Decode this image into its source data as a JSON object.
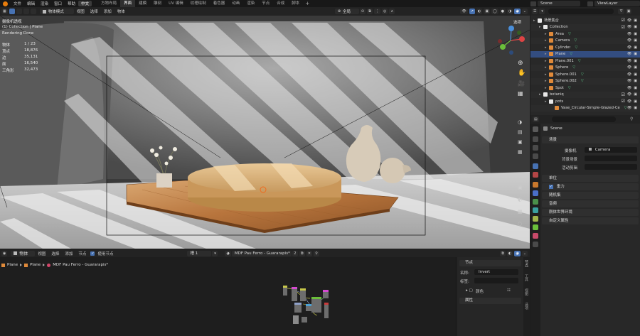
{
  "topbar": {
    "menus": [
      "文件",
      "编辑",
      "渲染",
      "窗口",
      "帮助",
      "中文"
    ],
    "workspaces": [
      "方物布局",
      "界面",
      "建模",
      "雕刻",
      "UV 编辑",
      "纹理绘制",
      "着色器",
      "动画",
      "渲染",
      "节点",
      "合成",
      "脚本"
    ],
    "active_workspace": "界面",
    "scene_label": "Scene",
    "viewlayer_label": "ViewLayer"
  },
  "viewport_header": {
    "mode": "物体模式",
    "menus": [
      "视图",
      "选择",
      "添加",
      "物体"
    ],
    "transform": "全局"
  },
  "overlay": {
    "view_name": "摄像机透视",
    "collection_object": "(1) Collection | Plane",
    "render_status": "Rendering Done",
    "stats": [
      {
        "label": "物体",
        "value": "1 / 23"
      },
      {
        "label": "顶点",
        "value": "18,876"
      },
      {
        "label": "边",
        "value": "35,131"
      },
      {
        "label": "面",
        "value": "16,540"
      },
      {
        "label": "三角形",
        "value": "32,473"
      }
    ],
    "stat_labels_short": [
      "体",
      "",
      "",
      "",
      "角形"
    ],
    "top_right_select": "选项"
  },
  "node_editor": {
    "menus": [
      "物体",
      "视图",
      "选择",
      "添加",
      "节点"
    ],
    "use_nodes_label": "使用节点",
    "slot": "槽 1",
    "material_name": "MDF Pau Ferro - Guararapis*",
    "breadcrumb": [
      "Plane",
      "Plane",
      "MDF Pau Ferro - Guararapis*"
    ],
    "sidebar": {
      "node_panel": "节点",
      "name_label": "名称:",
      "name_value": "Invert",
      "label_label": "标签:",
      "label_value": "",
      "color_panel": "颜色",
      "props_panel": "属性"
    },
    "tabs": [
      "节点",
      "工具",
      "视图",
      "选项"
    ]
  },
  "outliner": {
    "search_placeholder": "",
    "rows": [
      {
        "label": "场景集合",
        "depth": 0,
        "type": "scene"
      },
      {
        "label": "Collection",
        "depth": 1,
        "type": "collection"
      },
      {
        "label": "Area",
        "depth": 2,
        "type": "light"
      },
      {
        "label": "Camera",
        "depth": 2,
        "type": "camera"
      },
      {
        "label": "Cylinder",
        "depth": 2,
        "type": "mesh"
      },
      {
        "label": "Plane",
        "depth": 2,
        "type": "mesh",
        "selected": true
      },
      {
        "label": "Plane.001",
        "depth": 2,
        "type": "mesh"
      },
      {
        "label": "Sphere",
        "depth": 2,
        "type": "mesh"
      },
      {
        "label": "Sphere.001",
        "depth": 2,
        "type": "mesh"
      },
      {
        "label": "Sphere.002",
        "depth": 2,
        "type": "mesh"
      },
      {
        "label": "Spot",
        "depth": 2,
        "type": "light"
      },
      {
        "label": "botaniq",
        "depth": 1,
        "type": "collection"
      },
      {
        "label": "pots",
        "depth": 2,
        "type": "collection"
      },
      {
        "label": "Vase_Circular-Simple-Glazed-Ce",
        "depth": 3,
        "type": "mesh"
      }
    ]
  },
  "properties": {
    "scene_name": "Scene",
    "scene_panel": "场景",
    "camera_label": "摄像机",
    "camera_value": "Camera",
    "background_label": "背景场景",
    "active_clip_label": "活动剪辑",
    "panels": [
      "单位",
      "重力",
      "随机集",
      "音频",
      "刚体世界环境",
      "自定义属性"
    ],
    "gravity_checked": true
  },
  "colors": {
    "accent": "#4772b3",
    "selected_row": "#334d80",
    "collection_icon": "#e8e8e8",
    "mesh_icon": "#e08a3a",
    "light_icon": "#e08a3a",
    "modifier_icon": "#5fcf8c"
  }
}
